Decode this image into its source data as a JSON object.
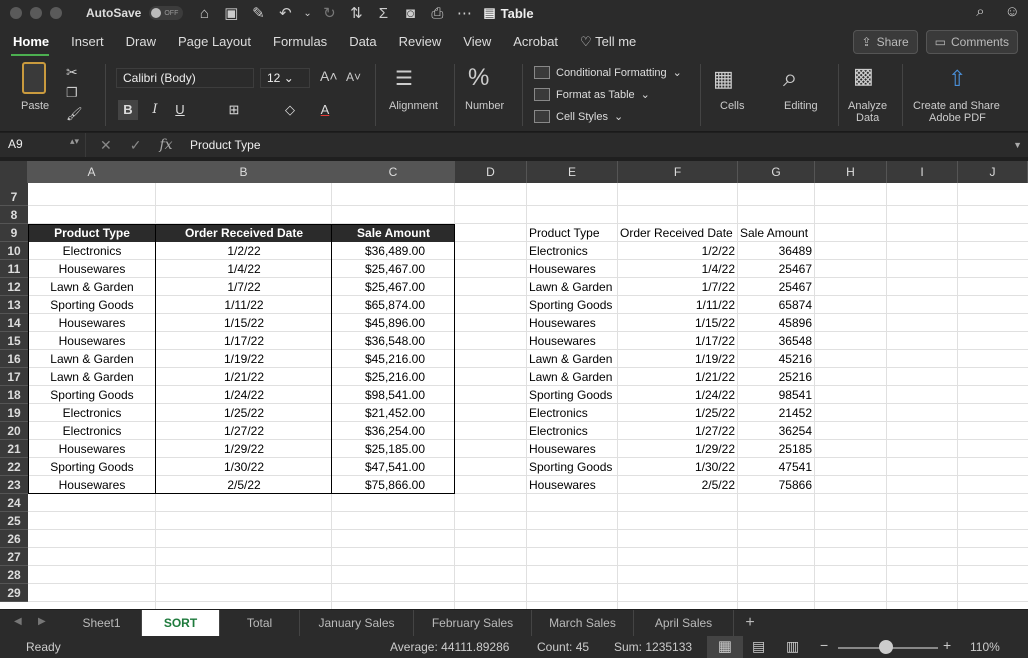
{
  "titlebar": {
    "autosave_label": "AutoSave",
    "autosave_state": "OFF",
    "title": "Table"
  },
  "menu": {
    "tabs": [
      "Home",
      "Insert",
      "Draw",
      "Page Layout",
      "Formulas",
      "Data",
      "Review",
      "View",
      "Acrobat"
    ],
    "tell_me": "Tell me",
    "share": "Share",
    "comments": "Comments"
  },
  "ribbon": {
    "paste": "Paste",
    "font_name": "Calibri (Body)",
    "font_size": "12",
    "alignment": "Alignment",
    "number": "Number",
    "conditional_formatting": "Conditional Formatting",
    "format_as_table": "Format as Table",
    "cell_styles": "Cell Styles",
    "cells": "Cells",
    "editing": "Editing",
    "analyze_data_1": "Analyze",
    "analyze_data_2": "Data",
    "create_share_1": "Create and Share",
    "create_share_2": "Adobe PDF"
  },
  "formula_bar": {
    "cell_ref": "A9",
    "fx": "fx",
    "content": "Product Type"
  },
  "columns": [
    "A",
    "B",
    "C",
    "D",
    "E",
    "F",
    "G",
    "H",
    "I",
    "J"
  ],
  "rows": [
    "7",
    "8",
    "9",
    "10",
    "11",
    "12",
    "13",
    "14",
    "15",
    "16",
    "17",
    "18",
    "19",
    "20",
    "21",
    "22",
    "23",
    "24",
    "25",
    "26",
    "27",
    "28",
    "29"
  ],
  "table_formatted": {
    "headers": [
      "Product Type",
      "Order Received Date",
      "Sale Amount"
    ],
    "rows": [
      [
        "Electronics",
        "1/2/22",
        "$36,489.00"
      ],
      [
        "Housewares",
        "1/4/22",
        "$25,467.00"
      ],
      [
        "Lawn & Garden",
        "1/7/22",
        "$25,467.00"
      ],
      [
        "Sporting Goods",
        "1/11/22",
        "$65,874.00"
      ],
      [
        "Housewares",
        "1/15/22",
        "$45,896.00"
      ],
      [
        "Housewares",
        "1/17/22",
        "$36,548.00"
      ],
      [
        "Lawn & Garden",
        "1/19/22",
        "$45,216.00"
      ],
      [
        "Lawn & Garden",
        "1/21/22",
        "$25,216.00"
      ],
      [
        "Sporting Goods",
        "1/24/22",
        "$98,541.00"
      ],
      [
        "Electronics",
        "1/25/22",
        "$21,452.00"
      ],
      [
        "Electronics",
        "1/27/22",
        "$36,254.00"
      ],
      [
        "Housewares",
        "1/29/22",
        "$25,185.00"
      ],
      [
        "Sporting Goods",
        "1/30/22",
        "$47,541.00"
      ],
      [
        "Housewares",
        "2/5/22",
        "$75,866.00"
      ]
    ]
  },
  "table_plain": {
    "headers": [
      "Product Type",
      "Order Received Date",
      "Sale Amount"
    ],
    "rows": [
      [
        "Electronics",
        "1/2/22",
        "36489"
      ],
      [
        "Housewares",
        "1/4/22",
        "25467"
      ],
      [
        "Lawn & Garden",
        "1/7/22",
        "25467"
      ],
      [
        "Sporting Goods",
        "1/11/22",
        "65874"
      ],
      [
        "Housewares",
        "1/15/22",
        "45896"
      ],
      [
        "Housewares",
        "1/17/22",
        "36548"
      ],
      [
        "Lawn & Garden",
        "1/19/22",
        "45216"
      ],
      [
        "Lawn & Garden",
        "1/21/22",
        "25216"
      ],
      [
        "Sporting Goods",
        "1/24/22",
        "98541"
      ],
      [
        "Electronics",
        "1/25/22",
        "21452"
      ],
      [
        "Electronics",
        "1/27/22",
        "36254"
      ],
      [
        "Housewares",
        "1/29/22",
        "25185"
      ],
      [
        "Sporting Goods",
        "1/30/22",
        "47541"
      ],
      [
        "Housewares",
        "2/5/22",
        "75866"
      ]
    ]
  },
  "sheets": {
    "tabs": [
      "Sheet1",
      "SORT",
      "Total",
      "January Sales",
      "February Sales",
      "March Sales",
      "April Sales"
    ],
    "active": "SORT",
    "add": "+"
  },
  "status": {
    "ready": "Ready",
    "average": "Average: 44111.89286",
    "count": "Count: 45",
    "sum": "Sum: 1235133",
    "zoom_minus": "−",
    "zoom_plus": "+",
    "zoom": "110%"
  },
  "colors": {
    "accent_green": "#1e7a3c",
    "table_header_bg": "#2b2b2b",
    "chrome_bg": "#2b2b2b"
  }
}
